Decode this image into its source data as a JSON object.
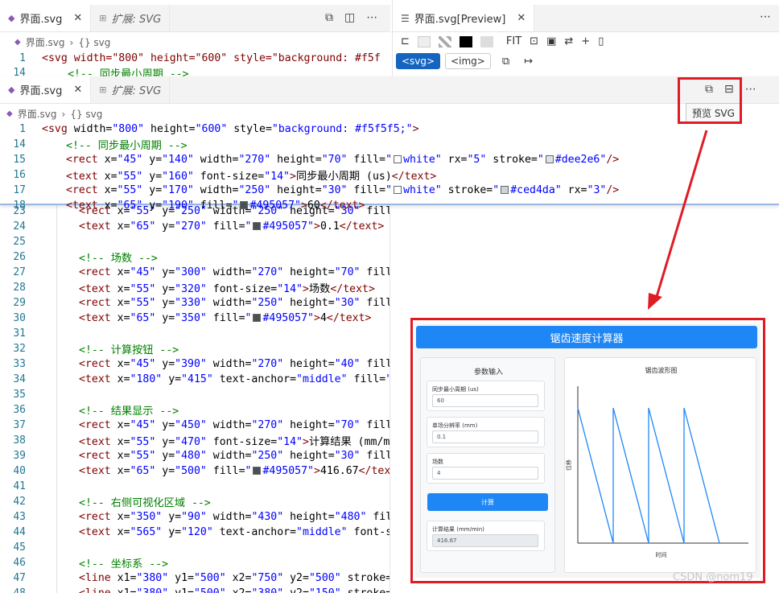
{
  "editor_top": {
    "tabs": [
      {
        "label": "界面.svg",
        "italic": false
      },
      {
        "label": "扩展: SVG",
        "italic": true
      }
    ],
    "close_glyph": "✕",
    "breadcrumb": [
      "界面.svg",
      "{} svg"
    ],
    "lines": [
      {
        "num": "1"
      },
      {
        "num": "14"
      }
    ],
    "line1_text": "<svg width=\"800\" height=\"600\" style=\"background: #f5f",
    "line14_text": "<!-- 同步最小周期 -->"
  },
  "preview_tab": {
    "label": "界面.svg[Preview]",
    "fit": "FIT",
    "svg_btn": "<svg>",
    "img_btn": "<img>"
  },
  "editor_popup": {
    "tabs": [
      {
        "label": "界面.svg"
      },
      {
        "label": "扩展: SVG"
      }
    ],
    "breadcrumb": [
      "界面.svg",
      "{} svg"
    ],
    "tooltip": "预览 SVG",
    "lines": [
      {
        "num": "1",
        "text": "<svg width=\"800\" height=\"600\" style=\"background: #f5f5f5;\">"
      },
      {
        "num": "14",
        "text": "<!-- 同步最小周期 -->"
      },
      {
        "num": "15",
        "text": "<rect x=\"45\" y=\"140\" width=\"270\" height=\"70\" fill=\"white\" rx=\"5\" stroke=\"#dee2e6\"/>"
      },
      {
        "num": "16",
        "text": "<text x=\"55\" y=\"160\" font-size=\"14\">同步最小周期 (us)</text>"
      },
      {
        "num": "17",
        "text": "<rect x=\"55\" y=\"170\" width=\"250\" height=\"30\" fill=\"white\" stroke=\"#ced4da\" rx=\"3\"/>"
      },
      {
        "num": "18",
        "text": "<text x=\"65\" y=\"190\" fill=\"#495057\">60</text>"
      }
    ]
  },
  "editor_main": {
    "lines": [
      {
        "num": "23",
        "text": "<rect x=\"55\" y=\"250\" width=\"250\" height=\"30\" fill="
      },
      {
        "num": "24",
        "text": "<text x=\"65\" y=\"270\" fill=\"#495057\">0.1</text>"
      },
      {
        "num": "25",
        "text": ""
      },
      {
        "num": "26",
        "text": "<!-- 场数 -->"
      },
      {
        "num": "27",
        "text": "<rect x=\"45\" y=\"300\" width=\"270\" height=\"70\" fill="
      },
      {
        "num": "28",
        "text": "<text x=\"55\" y=\"320\" font-size=\"14\">场数</text>"
      },
      {
        "num": "29",
        "text": "<rect x=\"55\" y=\"330\" width=\"250\" height=\"30\" fill="
      },
      {
        "num": "30",
        "text": "<text x=\"65\" y=\"350\" fill=\"#495057\">4</text>"
      },
      {
        "num": "31",
        "text": ""
      },
      {
        "num": "32",
        "text": "<!-- 计算按钮 -->"
      },
      {
        "num": "33",
        "text": "<rect x=\"45\" y=\"390\" width=\"270\" height=\"40\" fill="
      },
      {
        "num": "34",
        "text": "<text x=\"180\" y=\"415\" text-anchor=\"middle\" fill=\""
      },
      {
        "num": "35",
        "text": ""
      },
      {
        "num": "36",
        "text": "<!-- 结果显示 -->"
      },
      {
        "num": "37",
        "text": "<rect x=\"45\" y=\"450\" width=\"270\" height=\"70\" fill="
      },
      {
        "num": "38",
        "text": "<text x=\"55\" y=\"470\" font-size=\"14\">计算结果 (mm/mi"
      },
      {
        "num": "39",
        "text": "<rect x=\"55\" y=\"480\" width=\"250\" height=\"30\" fill="
      },
      {
        "num": "40",
        "text": "<text x=\"65\" y=\"500\" fill=\"#495057\">416.67</text"
      },
      {
        "num": "41",
        "text": ""
      },
      {
        "num": "42",
        "text": "<!-- 右侧可视化区域 -->"
      },
      {
        "num": "43",
        "text": "<rect x=\"350\" y=\"90\" width=\"430\" height=\"480\" fill"
      },
      {
        "num": "44",
        "text": "<text x=\"565\" y=\"120\" text-anchor=\"middle\" font-si"
      },
      {
        "num": "45",
        "text": ""
      },
      {
        "num": "46",
        "text": "<!-- 坐标系 -->"
      },
      {
        "num": "47",
        "text": "<line x1=\"380\" y1=\"500\" x2=\"750\" y2=\"500\" stroke=\""
      },
      {
        "num": "48",
        "text": "<line x1=\"380\" y1=\"500\" x2=\"380\" y2=\"150\" stroke=\""
      }
    ]
  },
  "preview": {
    "title": "锯齿速度计算器",
    "params_title": "参数输入",
    "fields": [
      {
        "label": "同步最小周期 (us)",
        "value": "60"
      },
      {
        "label": "单场分辨率 (mm)",
        "value": "0.1"
      },
      {
        "label": "场数",
        "value": "4"
      }
    ],
    "calc_button": "计算",
    "result_label": "计算结果 (mm/min)",
    "result_value": "416.67",
    "chart_title": "锯齿波形图",
    "xlabel": "时间",
    "ylabel": "位移"
  },
  "colors": {
    "accent": "#1f87f5",
    "highlight": "#e01b24"
  },
  "watermark": "CSDN @nom19"
}
